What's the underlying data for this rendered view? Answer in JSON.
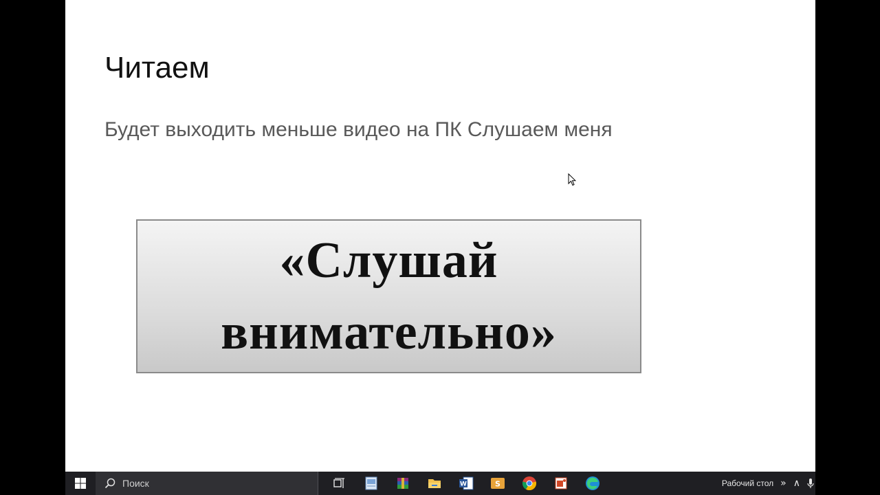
{
  "slide": {
    "title": "Читаем",
    "subtitle": "Будет выходить меньше видео на ПК Слушаем меня",
    "banner": {
      "line1": "«Слушай",
      "line2": "внимательно»"
    }
  },
  "taskbar": {
    "search_placeholder": "Поиск",
    "pinned_apps": [
      {
        "icon": "task-view-icon"
      },
      {
        "icon": "presentation-app-icon"
      },
      {
        "icon": "winrar-icon"
      },
      {
        "icon": "file-explorer-icon"
      },
      {
        "icon": "word-icon"
      },
      {
        "icon": "slides-app-icon"
      },
      {
        "icon": "chrome-icon"
      },
      {
        "icon": "office-icon"
      },
      {
        "icon": "edge-icon"
      }
    ],
    "tray": {
      "toolbar_label": "Рабочий стол",
      "expand_glyph": "»",
      "overflow_glyph": "∧"
    }
  },
  "colors": {
    "taskbar_bg": "#1f1f23",
    "slide_bg": "#ffffff",
    "subtitle_text": "#595959"
  }
}
